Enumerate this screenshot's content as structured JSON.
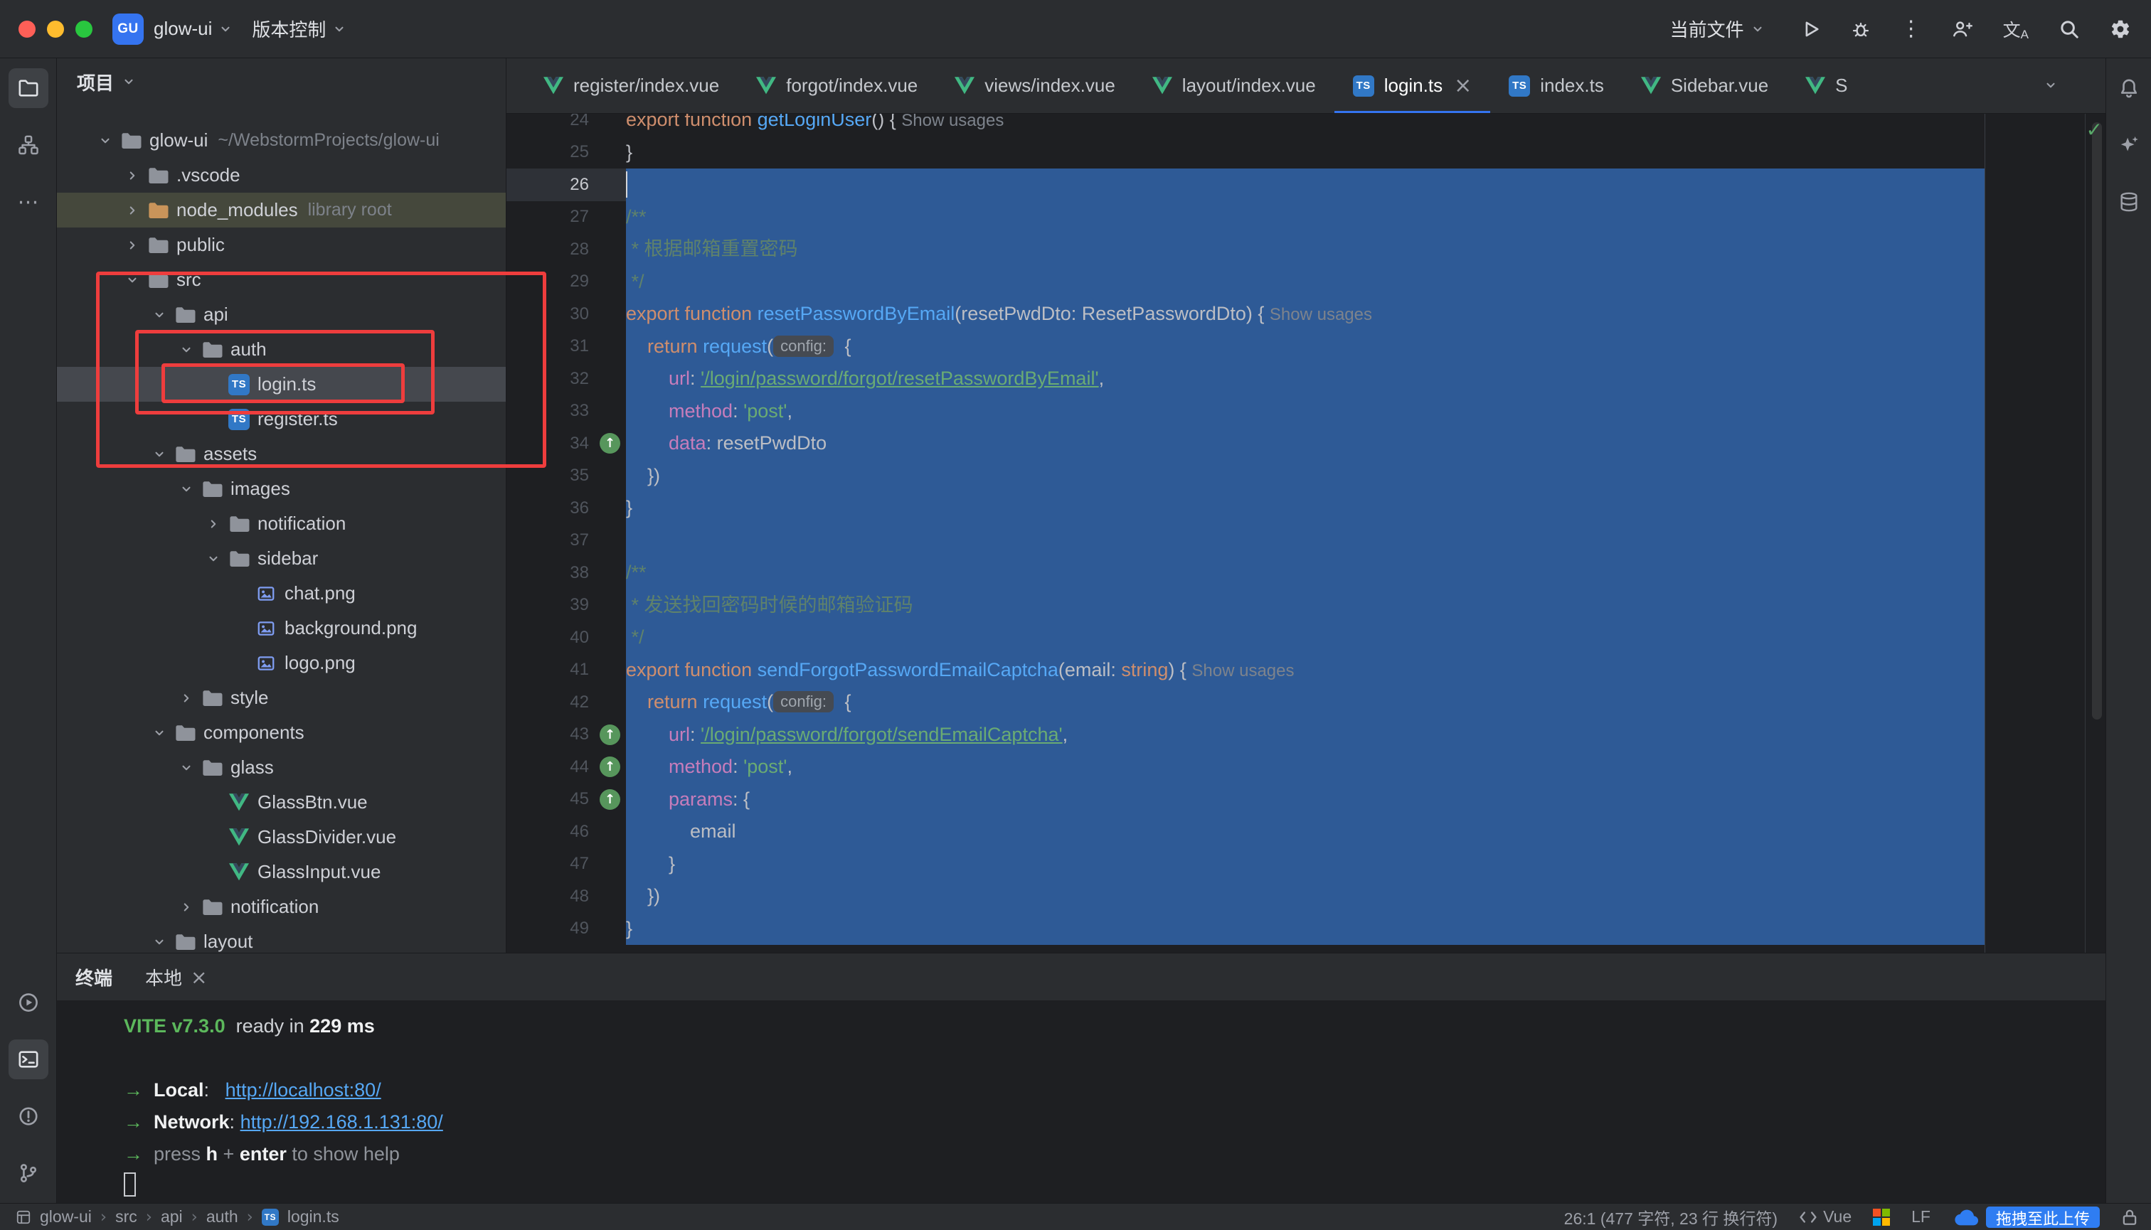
{
  "icons": {
    "close": "×",
    "more_v": "⋮",
    "more_h": "⋯",
    "check": "✓",
    "arrow_up": "↑",
    "translate": "文A",
    "crumb_sep": "›",
    "terminal_arrow": "→"
  },
  "window": {
    "logo_text": "GU",
    "title_project": "glow-ui",
    "vcs_menu": "版本控制",
    "run_config": "当前文件"
  },
  "tool_strips": {
    "left_top": [
      {
        "id": "project",
        "active": true
      },
      {
        "id": "structure",
        "active": false
      },
      {
        "id": "more-tools",
        "active": false
      }
    ],
    "left_bottom": [
      {
        "id": "services",
        "active": false
      },
      {
        "id": "terminal",
        "active": true
      },
      {
        "id": "problems",
        "active": false
      },
      {
        "id": "git",
        "active": false
      }
    ],
    "right": [
      {
        "id": "notifications",
        "active": false
      },
      {
        "id": "ai-assistant",
        "active": false
      },
      {
        "id": "database",
        "active": false
      }
    ],
    "titlebar_actions": [
      "run",
      "debug",
      "more",
      "code-with-me",
      "translate",
      "search",
      "settings"
    ]
  },
  "project": {
    "header": "项目",
    "tree": [
      {
        "label": "glow-ui",
        "secondary": "~/WebstormProjects/glow-ui",
        "level": 0,
        "icon": "folder",
        "chevron": "open"
      },
      {
        "label": ".vscode",
        "level": 1,
        "icon": "folder",
        "chevron": "closed"
      },
      {
        "label": "node_modules",
        "secondary": "library root",
        "level": 1,
        "icon": "folder",
        "chevron": "closed",
        "excluded": true,
        "folder_color": "#c9945a"
      },
      {
        "label": "public",
        "level": 1,
        "icon": "folder",
        "chevron": "closed"
      },
      {
        "label": "src",
        "level": 1,
        "icon": "folder",
        "chevron": "open"
      },
      {
        "label": "api",
        "level": 2,
        "icon": "folder",
        "chevron": "open"
      },
      {
        "label": "auth",
        "level": 3,
        "icon": "folder",
        "chevron": "open"
      },
      {
        "label": "login.ts",
        "level": 4,
        "icon": "ts",
        "selected": true
      },
      {
        "label": "register.ts",
        "level": 4,
        "icon": "ts"
      },
      {
        "label": "assets",
        "level": 2,
        "icon": "folder",
        "chevron": "open"
      },
      {
        "label": "images",
        "level": 3,
        "icon": "folder",
        "chevron": "open"
      },
      {
        "label": "notification",
        "level": 4,
        "icon": "folder",
        "chevron": "closed"
      },
      {
        "label": "sidebar",
        "level": 4,
        "icon": "folder",
        "chevron": "open"
      },
      {
        "label": "chat.png",
        "level": 5,
        "icon": "image"
      },
      {
        "label": "background.png",
        "level": 5,
        "icon": "image"
      },
      {
        "label": "logo.png",
        "level": 5,
        "icon": "image"
      },
      {
        "label": "style",
        "level": 3,
        "icon": "folder",
        "chevron": "closed"
      },
      {
        "label": "components",
        "level": 2,
        "icon": "folder",
        "chevron": "open"
      },
      {
        "label": "glass",
        "level": 3,
        "icon": "folder",
        "chevron": "open"
      },
      {
        "label": "GlassBtn.vue",
        "level": 4,
        "icon": "vue"
      },
      {
        "label": "GlassDivider.vue",
        "level": 4,
        "icon": "vue"
      },
      {
        "label": "GlassInput.vue",
        "level": 4,
        "icon": "vue"
      },
      {
        "label": "notification",
        "level": 3,
        "icon": "folder",
        "chevron": "closed"
      },
      {
        "label": "layout",
        "level": 2,
        "icon": "folder",
        "chevron": "open"
      }
    ]
  },
  "tabs": [
    {
      "label": "register/index.vue",
      "icon": "vue"
    },
    {
      "label": "forgot/index.vue",
      "icon": "vue"
    },
    {
      "label": "views/index.vue",
      "icon": "vue"
    },
    {
      "label": "layout/index.vue",
      "icon": "vue"
    },
    {
      "label": "login.ts",
      "icon": "ts",
      "active": true
    },
    {
      "label": "index.ts",
      "icon": "ts"
    },
    {
      "label": "Sidebar.vue",
      "icon": "vue"
    },
    {
      "label": "S",
      "icon": "vue",
      "partial": true
    }
  ],
  "editor": {
    "lines": [
      {
        "n": 24,
        "sel": false,
        "t": [
          [
            "kw",
            "export "
          ],
          [
            "kw",
            "function "
          ],
          [
            "fn",
            "getLoginUser"
          ],
          [
            "d",
            "() { "
          ],
          [
            "usage",
            "Show usages"
          ]
        ]
      },
      {
        "n": 25,
        "sel": false,
        "t": [
          [
            "d",
            "}"
          ]
        ]
      },
      {
        "n": 26,
        "sel": true,
        "caret": true,
        "t": []
      },
      {
        "n": 27,
        "sel": true,
        "t": [
          [
            "cmt",
            "/**"
          ]
        ]
      },
      {
        "n": 28,
        "sel": true,
        "t": [
          [
            "cmt",
            " * 根据邮箱重置密码"
          ]
        ]
      },
      {
        "n": 29,
        "sel": true,
        "t": [
          [
            "cmt",
            " */"
          ]
        ]
      },
      {
        "n": 30,
        "sel": true,
        "t": [
          [
            "kw",
            "export "
          ],
          [
            "kw",
            "function "
          ],
          [
            "fn",
            "resetPasswordByEmail"
          ],
          [
            "d",
            "(resetPwdDto: ResetPasswordDto) { "
          ],
          [
            "usage",
            "Show usages"
          ]
        ]
      },
      {
        "n": 31,
        "sel": true,
        "t": [
          [
            "d",
            "    "
          ],
          [
            "kw",
            "return "
          ],
          [
            "fn",
            "request"
          ],
          [
            "d",
            "("
          ],
          [
            "inlay",
            "config:"
          ],
          [
            "d",
            " {"
          ]
        ]
      },
      {
        "n": 32,
        "sel": true,
        "t": [
          [
            "d",
            "        "
          ],
          [
            "prop",
            "url"
          ],
          [
            "d",
            ": "
          ],
          [
            "strlink",
            "'/login/password/forgot/resetPasswordByEmail'"
          ],
          [
            "d",
            ","
          ]
        ]
      },
      {
        "n": 33,
        "sel": true,
        "t": [
          [
            "d",
            "        "
          ],
          [
            "prop",
            "method"
          ],
          [
            "d",
            ": "
          ],
          [
            "str",
            "'post'"
          ],
          [
            "d",
            ","
          ]
        ]
      },
      {
        "n": 34,
        "sel": true,
        "gicon": true,
        "t": [
          [
            "d",
            "        "
          ],
          [
            "prop",
            "data"
          ],
          [
            "d",
            ": resetPwdDto"
          ]
        ]
      },
      {
        "n": 35,
        "sel": true,
        "t": [
          [
            "d",
            "    })"
          ]
        ]
      },
      {
        "n": 36,
        "sel": true,
        "t": [
          [
            "d",
            "}"
          ]
        ]
      },
      {
        "n": 37,
        "sel": true,
        "t": []
      },
      {
        "n": 38,
        "sel": true,
        "t": [
          [
            "cmt",
            "/**"
          ]
        ]
      },
      {
        "n": 39,
        "sel": true,
        "t": [
          [
            "cmt",
            " * 发送找回密码时候的邮箱验证码"
          ]
        ]
      },
      {
        "n": 40,
        "sel": true,
        "t": [
          [
            "cmt",
            " */"
          ]
        ]
      },
      {
        "n": 41,
        "sel": true,
        "t": [
          [
            "kw",
            "export "
          ],
          [
            "kw",
            "function "
          ],
          [
            "fn",
            "sendForgotPasswordEmailCaptcha"
          ],
          [
            "d",
            "(email: "
          ],
          [
            "kw",
            "string"
          ],
          [
            "d",
            ") { "
          ],
          [
            "usage",
            "Show usages"
          ]
        ]
      },
      {
        "n": 42,
        "sel": true,
        "t": [
          [
            "d",
            "    "
          ],
          [
            "kw",
            "return "
          ],
          [
            "fn",
            "request"
          ],
          [
            "d",
            "("
          ],
          [
            "inlay",
            "config:"
          ],
          [
            "d",
            " {"
          ]
        ]
      },
      {
        "n": 43,
        "sel": true,
        "gicon": true,
        "t": [
          [
            "d",
            "        "
          ],
          [
            "prop",
            "url"
          ],
          [
            "d",
            ": "
          ],
          [
            "strlink",
            "'/login/password/forgot/sendEmailCaptcha'"
          ],
          [
            "d",
            ","
          ]
        ]
      },
      {
        "n": 44,
        "sel": true,
        "gicon": true,
        "t": [
          [
            "d",
            "        "
          ],
          [
            "prop",
            "method"
          ],
          [
            "d",
            ": "
          ],
          [
            "str",
            "'post'"
          ],
          [
            "d",
            ","
          ]
        ]
      },
      {
        "n": 45,
        "sel": true,
        "gicon": true,
        "t": [
          [
            "d",
            "        "
          ],
          [
            "prop",
            "params"
          ],
          [
            "d",
            ": {"
          ]
        ]
      },
      {
        "n": 46,
        "sel": true,
        "t": [
          [
            "d",
            "            email"
          ]
        ]
      },
      {
        "n": 47,
        "sel": true,
        "t": [
          [
            "d",
            "        }"
          ]
        ]
      },
      {
        "n": 48,
        "sel": true,
        "t": [
          [
            "d",
            "    })"
          ]
        ]
      },
      {
        "n": 49,
        "sel": true,
        "t": [
          [
            "d",
            "}"
          ]
        ]
      }
    ]
  },
  "terminal": {
    "title": "终端",
    "tab": "本地",
    "lines": [
      [
        [
          "vite",
          "VITE v7.3.0"
        ],
        [
          "t",
          "  ready in "
        ],
        [
          "b",
          "229 ms"
        ]
      ],
      [],
      [
        [
          "arrow",
          "→"
        ],
        [
          "t",
          "  "
        ],
        [
          "b",
          "Local"
        ],
        [
          "t",
          ":   "
        ],
        [
          "link",
          "http://localhost:80/"
        ]
      ],
      [
        [
          "arrow",
          "→"
        ],
        [
          "t",
          "  "
        ],
        [
          "b",
          "Network"
        ],
        [
          "t",
          ": "
        ],
        [
          "link",
          "http://192.168.1.131:80/"
        ]
      ],
      [
        [
          "arrow",
          "→"
        ],
        [
          "dim",
          "  press "
        ],
        [
          "b",
          "h"
        ],
        [
          "dim",
          " + "
        ],
        [
          "b",
          "enter"
        ],
        [
          "dim",
          " to show help"
        ]
      ],
      [
        [
          "cursor",
          ""
        ]
      ]
    ]
  },
  "statusbar": {
    "breadcrumbs": [
      "glow-ui",
      "src",
      "api",
      "auth",
      "login.ts"
    ],
    "position": "26:1 (477 字符, 23 行 换行符)",
    "framework": "Vue",
    "line_ending": "LF",
    "upload_button": "拖拽至此上传"
  },
  "annotations": {
    "color": "#ee3d3d",
    "rects": [
      [
        135,
        382,
        633,
        276
      ],
      [
        190,
        464,
        421,
        119
      ],
      [
        227,
        511,
        342,
        56
      ]
    ]
  }
}
